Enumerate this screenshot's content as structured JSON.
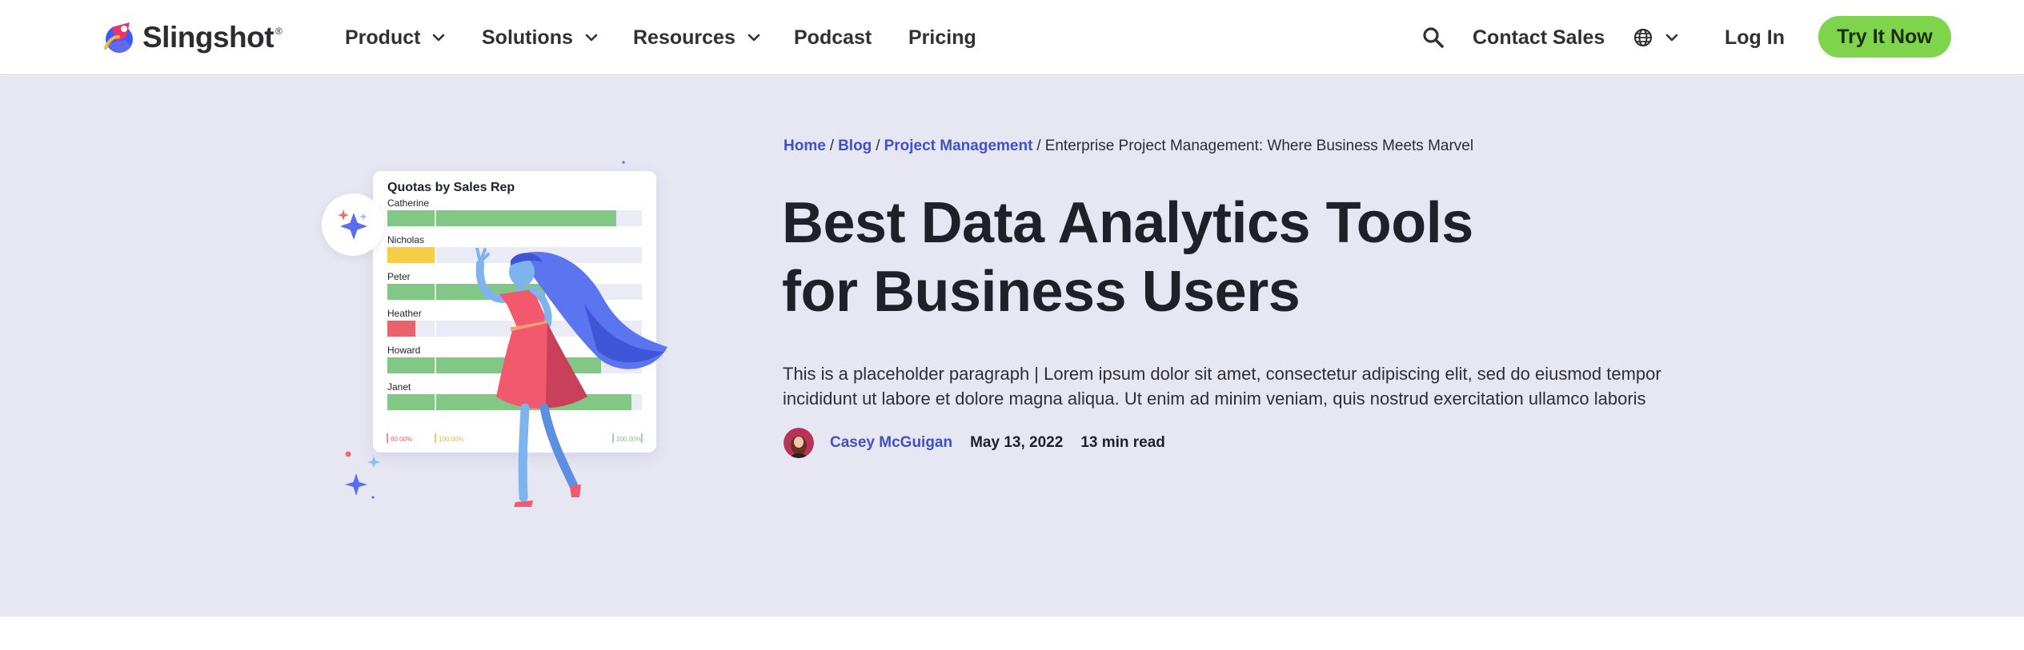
{
  "brand": {
    "name": "Slingshot",
    "mark": "®"
  },
  "nav": {
    "product": "Product",
    "solutions": "Solutions",
    "resources": "Resources",
    "podcast": "Podcast",
    "pricing": "Pricing",
    "contact": "Contact Sales",
    "login": "Log In",
    "cta": "Try It Now"
  },
  "breadcrumb": {
    "home": "Home",
    "blog": "Blog",
    "category": "Project Management",
    "current": "Enterprise Project Management: Where Business Meets Marvel"
  },
  "article": {
    "title_line1": "Best Data Analytics Tools",
    "title_line2": "for Business Users",
    "intro": "This is a placeholder paragraph | Lorem ipsum dolor sit amet, consectetur adipiscing elit, sed do eiusmod tempor incididunt ut labore et dolore magna aliqua. Ut enim ad minim veniam, quis nostrud exercitation ullamco laboris",
    "author": "Casey McGuigan",
    "date": "May 13, 2022",
    "read_time": "13 min read"
  },
  "illustration_chart": {
    "title": "Quotas by Sales Rep",
    "reps": [
      {
        "name": "Catherine",
        "fraction": 0.9,
        "color": "#82c785"
      },
      {
        "name": "Nicholas",
        "fraction": 0.19,
        "color": "#f7cd47"
      },
      {
        "name": "Peter",
        "fraction": 0.62,
        "color": "#82c785"
      },
      {
        "name": "Heather",
        "fraction": 0.11,
        "color": "#e9636b"
      },
      {
        "name": "Howard",
        "fraction": 0.84,
        "color": "#82c785"
      },
      {
        "name": "Janet",
        "fraction": 0.96,
        "color": "#82c785"
      }
    ],
    "markers": [
      {
        "label": "60.00%",
        "color": "#e9636b"
      },
      {
        "label": "100.00%",
        "color": "#e9b63c"
      },
      {
        "label": "200.00%",
        "color": "#82c785"
      }
    ]
  },
  "colors": {
    "accent_blue": "#3f51c4",
    "cta_green": "#7ed44a",
    "hero_bg": "#e7e7f3"
  },
  "icons": {
    "search": "search-icon",
    "globe": "globe-icon",
    "chevron": "chevron-down-icon",
    "logo": "slingshot-logo-icon"
  }
}
